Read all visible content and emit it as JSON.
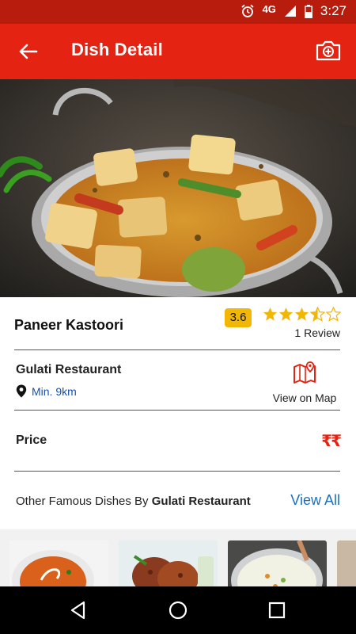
{
  "status": {
    "network": "4G",
    "time": "3:27"
  },
  "appbar": {
    "title": "Dish Detail",
    "back_icon": "arrow-back-icon",
    "camera_icon": "add-photo-icon"
  },
  "hero": {
    "image": "paneer-kastoori-dish-photo"
  },
  "dish": {
    "name": "Paneer Kastoori",
    "rating": "3.6",
    "stars": 3.5,
    "reviews": "1 Review"
  },
  "restaurant": {
    "name": "Gulati Restaurant",
    "distance": "Min. 9km",
    "map_label": "View on Map"
  },
  "price": {
    "label": "Price",
    "value": "₹₹"
  },
  "other": {
    "prefix": "Other Famous Dishes By ",
    "restaurant": "Gulati Restaurant",
    "view_all": "View All"
  },
  "colors": {
    "primary": "#e42313",
    "status_bar": "#b71c0c",
    "star": "#f2b705",
    "link": "#1a6fc2"
  },
  "navbar": {
    "icons": [
      "back-triangle-icon",
      "home-circle-icon",
      "recents-square-icon"
    ]
  }
}
